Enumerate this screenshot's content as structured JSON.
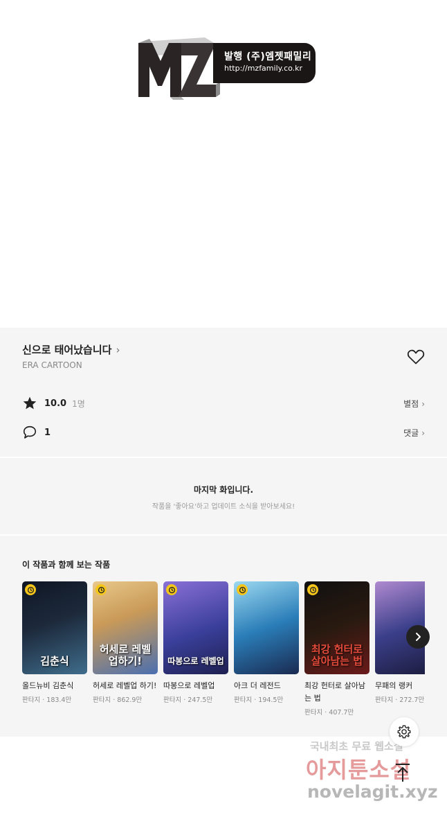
{
  "publisher": {
    "logo_letters": "MZ",
    "line1": "발행 (주)엠젯패밀리",
    "line2": "http://mzfamily.co.kr"
  },
  "work": {
    "title": "신으로 태어났습니다",
    "title_arrow": "›",
    "author": "ERA CARTOON",
    "heart_icon": "heart-outline-icon"
  },
  "rating": {
    "score": "10.0",
    "count": "1명",
    "link_label": "별점",
    "icon": "star-icon"
  },
  "comments": {
    "count": "1",
    "link_label": "댓글",
    "icon": "comment-bubble-icon"
  },
  "last_episode": {
    "title": "마지막 화입니다.",
    "subtitle": "작품을 '좋아요'하고 업데이트 소식을 받아보세요!"
  },
  "recommendations": {
    "title": "이 작품과 함께 보는 작품",
    "items": [
      {
        "name": "올드뉴비 김춘식",
        "meta": "판타지 · 183.4만",
        "cover_text": "김춘식",
        "c1": "#1d2a3c",
        "c2": "#3f6d8c"
      },
      {
        "name": "허세로 레벨업 하기!",
        "meta": "판타지 · 862.9만",
        "cover_text": "허세로 레벨업하기!",
        "c1": "#c99a58",
        "c2": "#4a6fb0"
      },
      {
        "name": "따봉으로 레벨업",
        "meta": "판타지 · 247.5만",
        "cover_text": "따봉으로 레벨업",
        "c1": "#3a3f9a",
        "c2": "#8a70d6"
      },
      {
        "name": "아크 더 레전드",
        "meta": "판타지 · 194.5만",
        "cover_text": "",
        "c1": "#2a7db8",
        "c2": "#9bd8f0"
      },
      {
        "name": "최강 헌터로 살아남는 법",
        "meta": "판타지 · 407.7만",
        "cover_text": "최강 헌터로 살아남는 법",
        "c1": "#101010",
        "c2": "#6a1a1a"
      },
      {
        "name": "무패의 랭커",
        "meta": "판타지 · 272.7만",
        "cover_text": "",
        "c1": "#3b3f8a",
        "c2": "#b08ad0"
      }
    ]
  },
  "watermark": {
    "line1": "국내최초 무료 웹소설",
    "line2": "아지툰소설",
    "line3": "novelagit.xyz"
  },
  "controls": {
    "next_icon": "chevron-right-icon",
    "settings_icon": "gear-icon",
    "top_icon": "arrow-up-to-top-icon"
  },
  "colors": {
    "panel_bg": "#f5f5f5",
    "badge": "#f4c51a",
    "text_primary": "#222222",
    "text_muted": "#888888"
  }
}
